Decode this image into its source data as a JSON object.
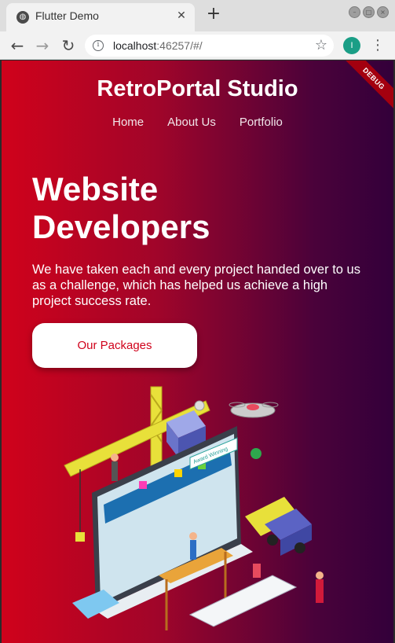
{
  "browser": {
    "tab_title": "Flutter Demo",
    "url_host": "localhost",
    "url_rest": ":46257/#/",
    "profile_initial": "I",
    "debug_label": "DEBUG"
  },
  "site": {
    "brand": "RetroPortal Studio",
    "nav": [
      "Home",
      "About Us",
      "Portfolio"
    ],
    "hero_title_line1": "Website",
    "hero_title_line2": "Developers",
    "hero_text": "We have taken each and every project handed over to us as a challenge, which has helped us achieve a high project success rate.",
    "cta_label": "Our Packages",
    "award_sign": "Award Winning"
  },
  "colors": {
    "gradient_start": "#d0021b",
    "gradient_end": "#33003a",
    "cta_text": "#d0021b"
  }
}
